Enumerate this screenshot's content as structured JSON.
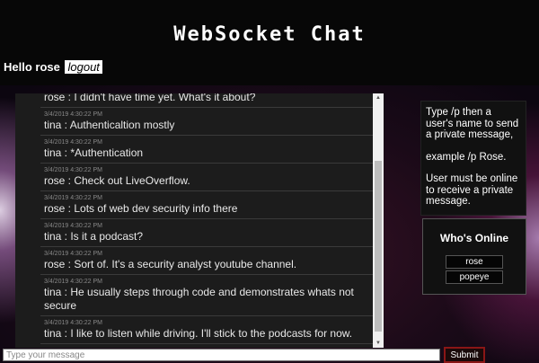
{
  "header": {
    "title": "WebSocket Chat",
    "greeting": "Hello rose",
    "logout_label": "logout"
  },
  "messages": [
    {
      "timestamp": "",
      "text": "rose : I didn't have time yet. What's it about?"
    },
    {
      "timestamp": "3/4/2019 4:30:22 PM",
      "text": "tina : Authenticaltion mostly"
    },
    {
      "timestamp": "3/4/2019 4:30:22 PM",
      "text": "tina : *Authentication"
    },
    {
      "timestamp": "3/4/2019 4:30:22 PM",
      "text": "rose : Check out LiveOverflow."
    },
    {
      "timestamp": "3/4/2019 4:30:22 PM",
      "text": "rose : Lots of web dev security info there"
    },
    {
      "timestamp": "3/4/2019 4:30:22 PM",
      "text": "tina : Is it a podcast?"
    },
    {
      "timestamp": "3/4/2019 4:30:22 PM",
      "text": "rose : Sort of. It's a security analyst youtube channel."
    },
    {
      "timestamp": "3/4/2019 4:30:22 PM",
      "text": "tina : He usually steps through code and demonstrates whats not secure"
    },
    {
      "timestamp": "3/4/2019 4:30:22 PM",
      "text": "tina : I like to listen while driving. I'll stick to the podcasts for now."
    }
  ],
  "help": {
    "line1": "Type /p then a user's name to send a private message,",
    "line2": "example /p Rose.",
    "line3": "User must be online to receive a private message."
  },
  "online": {
    "title": "Who's Online",
    "users": [
      "rose",
      "popeye"
    ]
  },
  "composer": {
    "placeholder": "Type your message",
    "submit_label": "Submit"
  }
}
